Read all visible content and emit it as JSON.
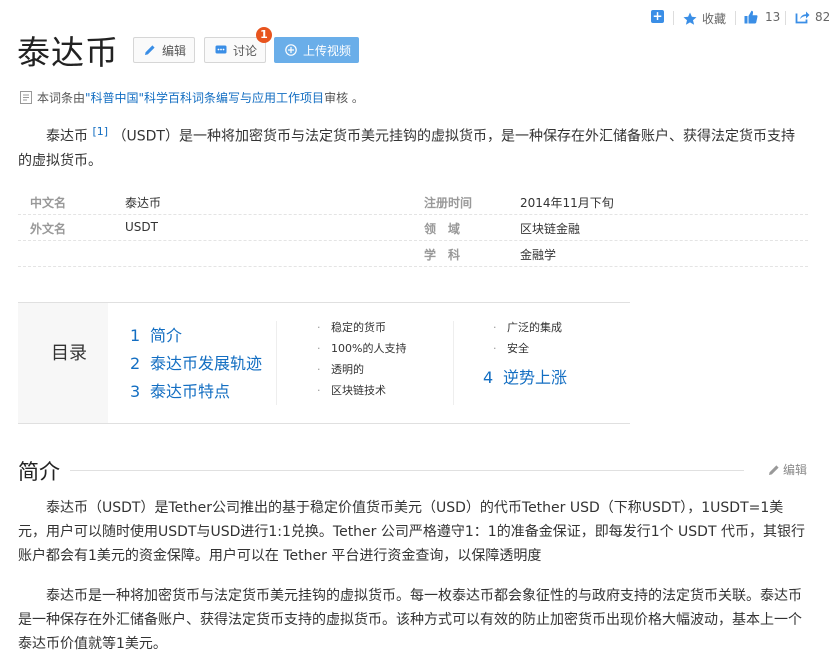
{
  "toolbar": {
    "plus_icon": "+",
    "favorite_label": "收藏",
    "like_count": "13",
    "share_count": "82"
  },
  "title": "泰达币",
  "actions": {
    "edit_label": "编辑",
    "discuss_label": "讨论",
    "discuss_badge": "1",
    "upload_label": "上传视频"
  },
  "review": {
    "prefix": "本词条由",
    "link": "\"科普中国\"科学百科词条编写与应用工作项目",
    "suffix": " 审核 。"
  },
  "summary": {
    "lead": "泰达币",
    "ref": "[1]",
    "rest": "（USDT）是一种将加密货币与法定货币美元挂钩的虚拟货币，是一种保存在外汇储备账户、获得法定货币支持的虚拟货币。"
  },
  "infobox": {
    "rows": [
      {
        "k1": "中文名",
        "v1": "泰达币",
        "k2": "注册时间",
        "v2": "2014年11月下旬"
      },
      {
        "k1": "外文名",
        "v1": "USDT",
        "k2": "领　域",
        "v2": "区块链金融"
      },
      {
        "k1": "",
        "v1": "",
        "k2": "学　科",
        "v2": "金融学"
      }
    ]
  },
  "catalog": {
    "title": "目录",
    "main": [
      {
        "num": "1",
        "label": "简介"
      },
      {
        "num": "2",
        "label": "泰达币发展轨迹"
      },
      {
        "num": "3",
        "label": "泰达币特点"
      },
      {
        "num": "4",
        "label": "逆势上涨"
      }
    ],
    "sub_col1": [
      "稳定的货币",
      "100%的人支持",
      "透明的",
      "区块链技术"
    ],
    "sub_col2": [
      "广泛的集成",
      "安全"
    ],
    "bullet": "·"
  },
  "section": {
    "heading": "简介",
    "edit_label": "编辑"
  },
  "paragraphs": [
    "泰达币（USDT）是Tether公司推出的基于稳定价值货币美元（USD）的代币Tether USD（下称USDT），1USDT=1美元，用户可以随时使用USDT与USD进行1:1兑换。Tether 公司严格遵守1：1的准备金保证，即每发行1个 USDT 代币，其银行账户都会有1美元的资金保障。用户可以在 Tether 平台进行资金查询，以保障透明度",
    "泰达币是一种将加密货币与法定货币美元挂钩的虚拟货币。每一枚泰达币都会象征性的与政府支持的法定货币关联。泰达币是一种保存在外汇储备账户、获得法定货币支持的虚拟货币。该种方式可以有效的防止加密货币出现价格大幅波动，基本上一个泰达币价值就等1美元。"
  ],
  "colors": {
    "link": "#136ec2",
    "accent_blue": "#3a8ee6",
    "badge": "#e8541e",
    "upload_button": "#6aaee9"
  }
}
